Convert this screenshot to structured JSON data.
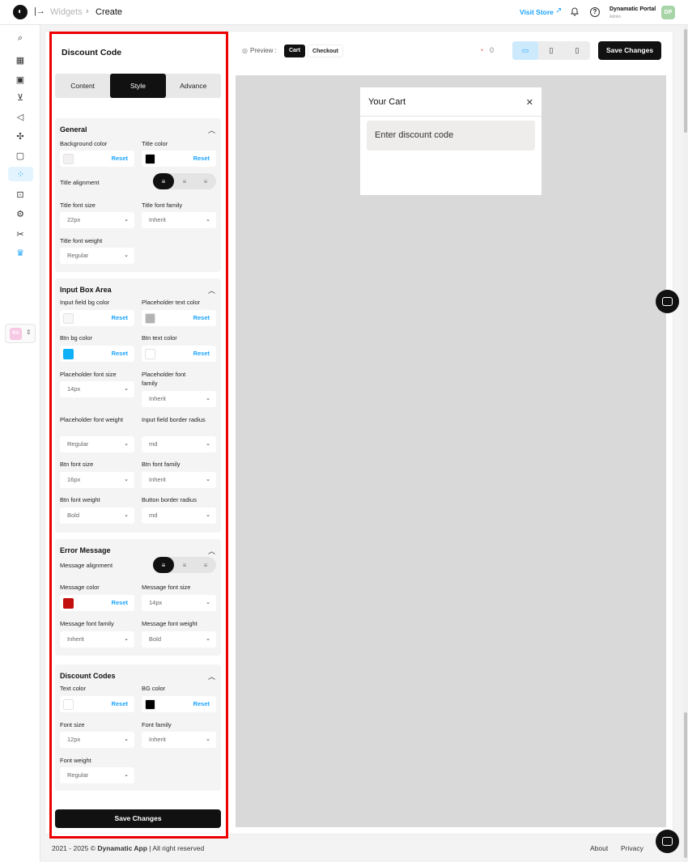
{
  "header": {
    "breadcrumb_parent": "Widgets",
    "breadcrumb_sep": "›",
    "breadcrumb_current": "Create",
    "visit_store": "Visit Store",
    "user_name": "Dynamatic Portal",
    "user_role": "Admin",
    "avatar_initials": "DP"
  },
  "sidebar": {
    "icons": [
      "search-icon",
      "dashboard-icon",
      "analytics-icon",
      "cart-icon",
      "megaphone-icon",
      "sparkle-icon",
      "widget-icon",
      "components-icon",
      "focus-icon",
      "settings-icon",
      "tools-icon",
      "crown-icon"
    ],
    "store_initials": "RA"
  },
  "panel": {
    "title": "Discount Code",
    "tabs": [
      "Content",
      "Style",
      "Advance"
    ],
    "active_tab": "Style",
    "reset_label": "Reset",
    "save_label": "Save Changes",
    "general": {
      "title": "General",
      "bg_color_label": "Background color",
      "bg_color": "#f2f0f0",
      "title_color_label": "Title color",
      "title_color": "#000000",
      "title_alignment_label": "Title alignment",
      "title_font_size_label": "Title font size",
      "title_font_size": "22px",
      "title_font_family_label": "Title font family",
      "title_font_family": "Inherit",
      "title_font_weight_label": "Title font weight",
      "title_font_weight": "Regular"
    },
    "input_box": {
      "title": "Input Box Area",
      "input_bg_label": "Input field bg color",
      "input_bg": "#f7f7f7",
      "placeholder_color_label": "Placeholder text color",
      "placeholder_color": "#b3b3b3",
      "btn_bg_label": "Btn bg color",
      "btn_bg": "#0fb0f5",
      "btn_text_color_label": "Btn text color",
      "btn_text_color": "#ffffff",
      "placeholder_font_size_label": "Placeholder font size",
      "placeholder_font_size": "14px",
      "placeholder_font_family_label": "Placeholder font family",
      "placeholder_font_family": "Inherit",
      "placeholder_font_weight_label": "Placeholder font weight",
      "placeholder_font_weight": "Regular",
      "input_border_radius_label": "Input field border radius",
      "input_border_radius": "md",
      "btn_font_size_label": "Btn font size",
      "btn_font_size": "16px",
      "btn_font_family_label": "Btn font family",
      "btn_font_family": "Inherit",
      "btn_font_weight_label": "Btn font weight",
      "btn_font_weight": "Bold",
      "btn_border_radius_label": "Button border radius",
      "btn_border_radius": "md"
    },
    "error": {
      "title": "Error Message",
      "alignment_label": "Message alignment",
      "color_label": "Message color",
      "color": "#c40f0f",
      "font_size_label": "Message font size",
      "font_size": "14px",
      "font_family_label": "Message font family",
      "font_family": "Inherit",
      "font_weight_label": "Message font weight",
      "font_weight": "Bold"
    },
    "codes": {
      "title": "Discount Codes",
      "text_color_label": "Text color",
      "text_color": "#ffffff",
      "bg_color_label": "BG color",
      "bg_color": "#000000",
      "font_size_label": "Font size",
      "font_size": "12px",
      "font_family_label": "Font family",
      "font_family": "Inherit",
      "font_weight_label": "Font weight",
      "font_weight": "Regular"
    }
  },
  "preview": {
    "label": "Preview :",
    "tabs": [
      "Cart",
      "Checkout"
    ],
    "message_count": "0",
    "save_label": "Save Changes",
    "cart_title": "Your Cart",
    "discount_placeholder": "Enter discount code"
  },
  "footer": {
    "years": "2021 - 2025 ©",
    "brand": "Dynamatic App",
    "rights": "| All right reserved",
    "about": "About",
    "privacy": "Privacy"
  },
  "colors": {
    "accent": "#1aa3ff",
    "highlight_border": "#ee0000"
  }
}
